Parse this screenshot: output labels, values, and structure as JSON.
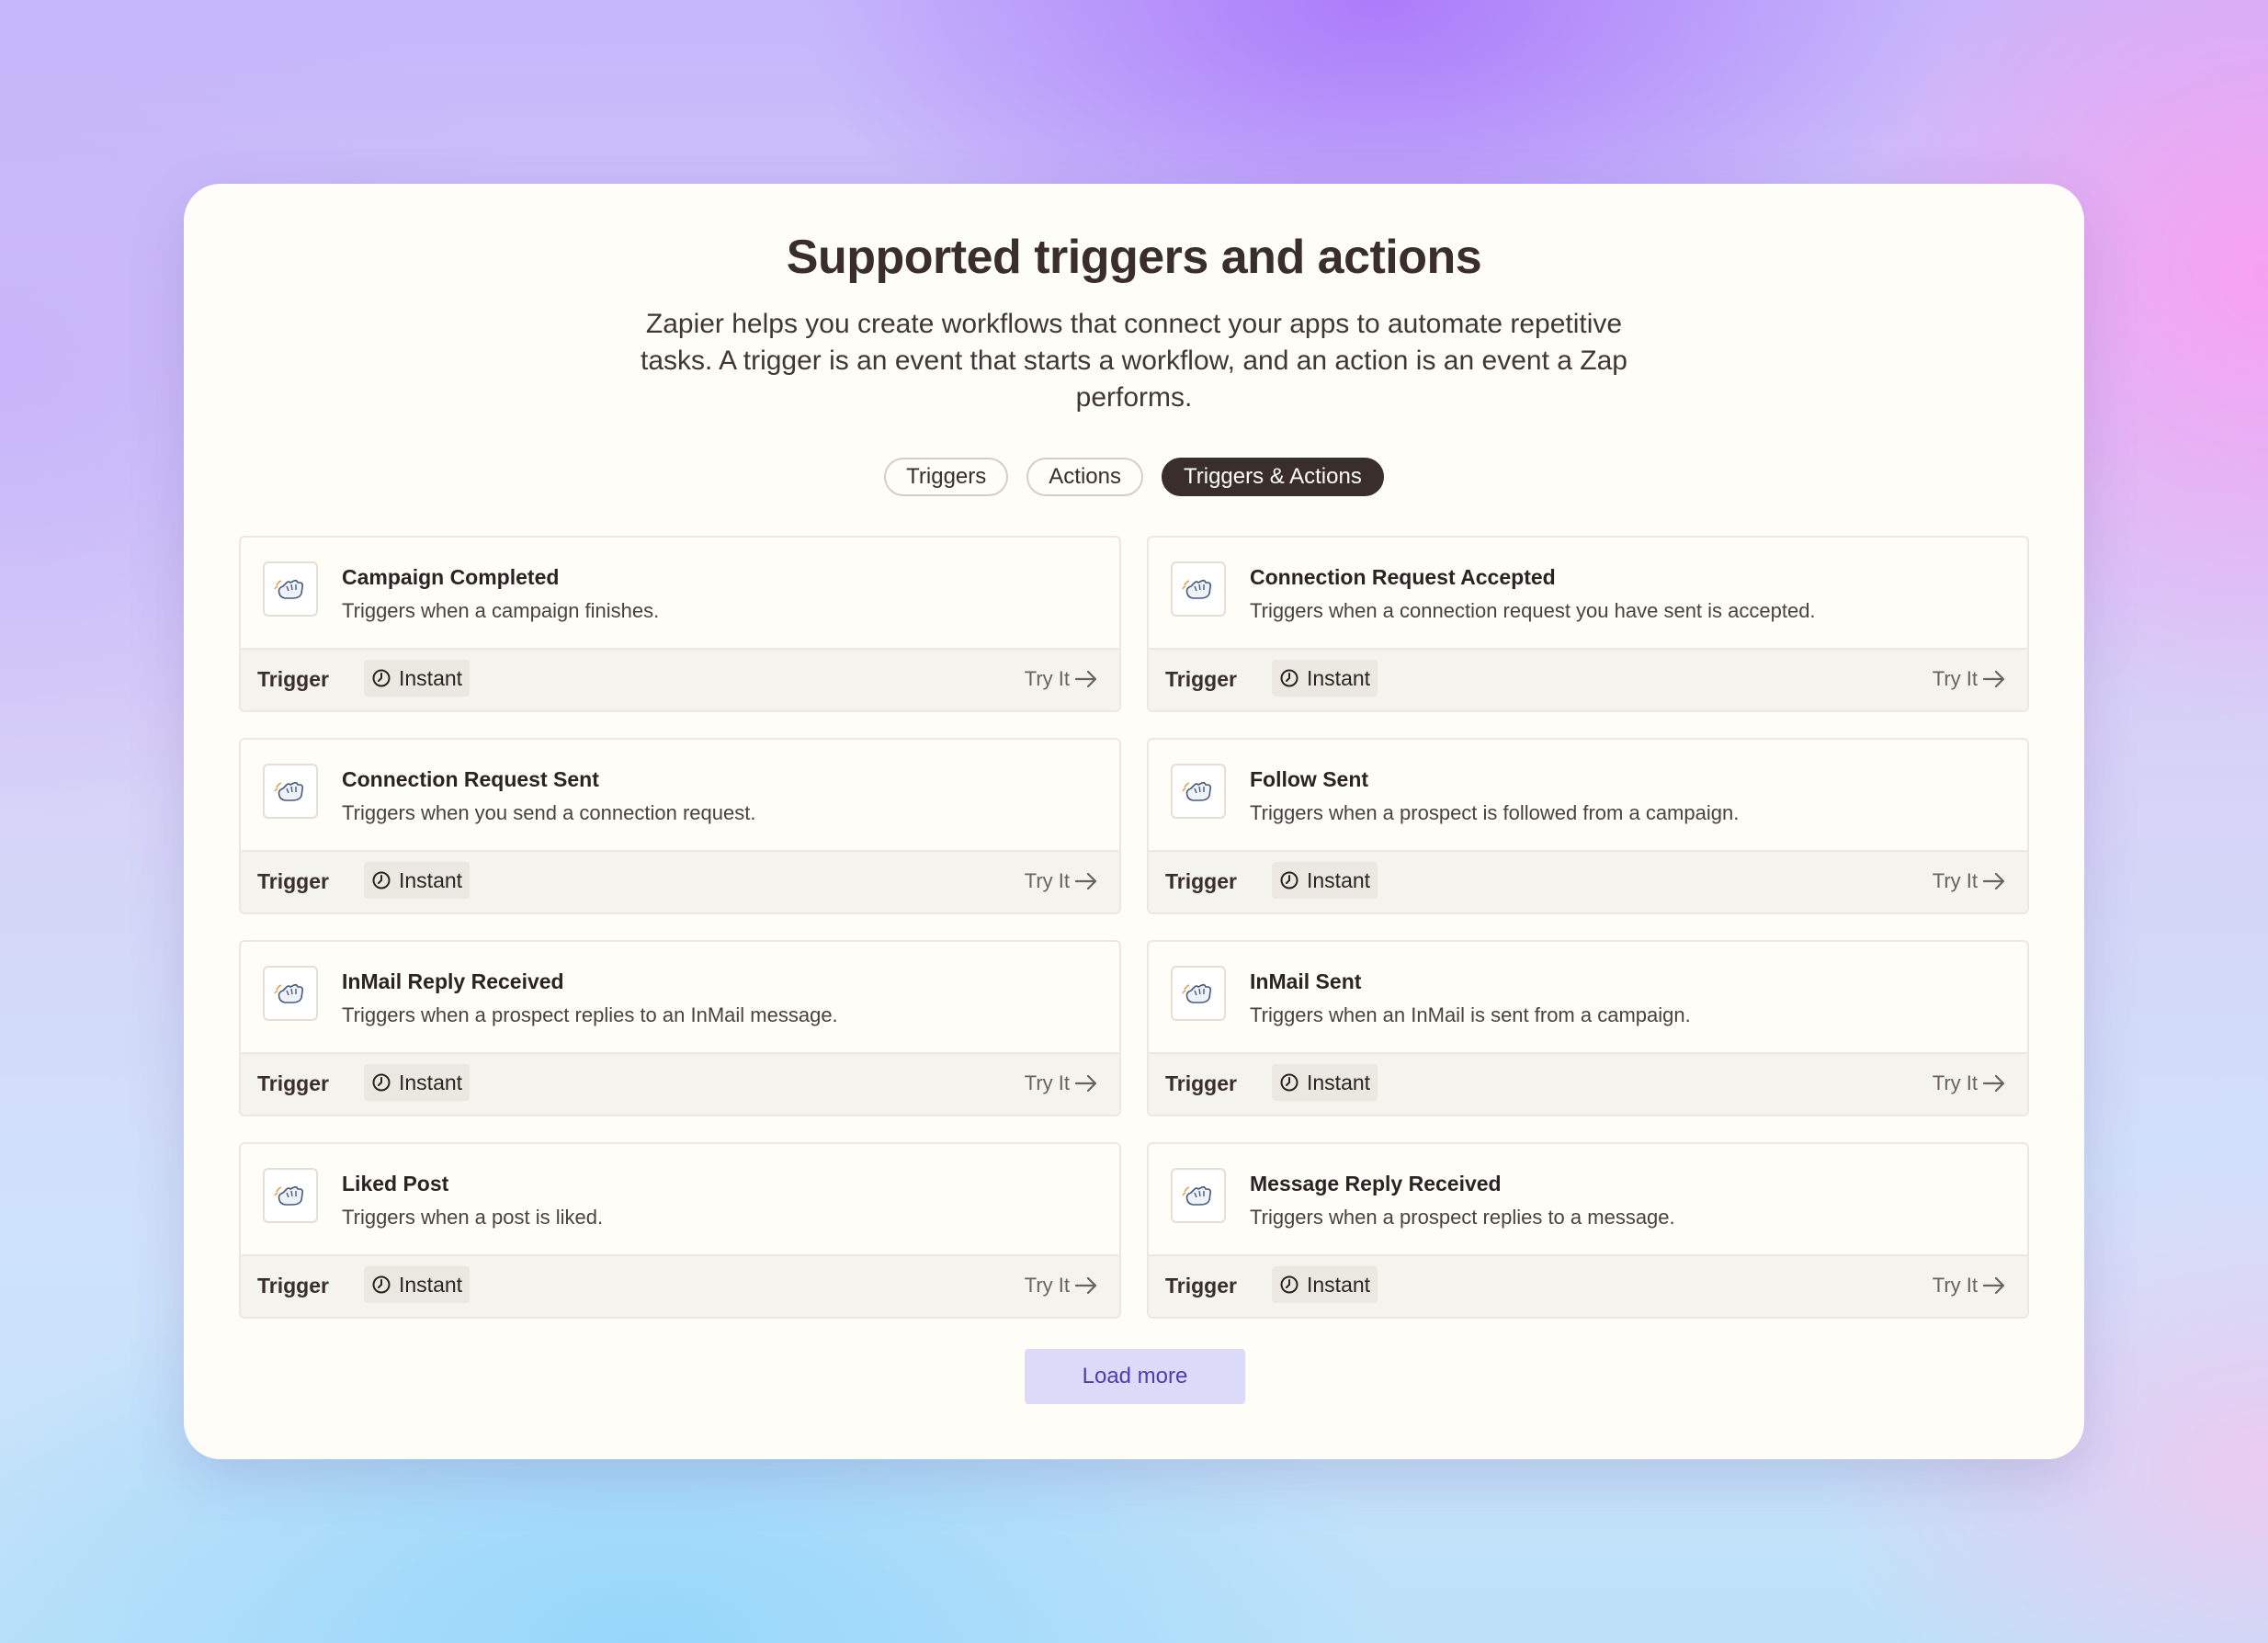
{
  "header": {
    "title": "Supported triggers and actions",
    "subtitle": "Zapier helps you create workflows that connect your apps to automate repetitive tasks. A trigger is an event that starts a workflow, and an action is an event a Zap performs."
  },
  "filters": {
    "triggers": "Triggers",
    "actions": "Actions",
    "both": "Triggers & Actions",
    "selected": "Triggers & Actions"
  },
  "items": [
    {
      "name": "Campaign Completed",
      "desc": "Triggers when a campaign finishes.",
      "type": "Trigger",
      "badge": "Instant",
      "cta": "Try It"
    },
    {
      "name": "Connection Request Accepted",
      "desc": "Triggers when a connection request you have sent is accepted.",
      "type": "Trigger",
      "badge": "Instant",
      "cta": "Try It"
    },
    {
      "name": "Connection Request Sent",
      "desc": "Triggers when you send a connection request.",
      "type": "Trigger",
      "badge": "Instant",
      "cta": "Try It"
    },
    {
      "name": "Follow Sent",
      "desc": "Triggers when a prospect is followed from a campaign.",
      "type": "Trigger",
      "badge": "Instant",
      "cta": "Try It"
    },
    {
      "name": "InMail Reply Received",
      "desc": "Triggers when a prospect replies to an InMail message.",
      "type": "Trigger",
      "badge": "Instant",
      "cta": "Try It"
    },
    {
      "name": "InMail Sent",
      "desc": "Triggers when an InMail is sent from a campaign.",
      "type": "Trigger",
      "badge": "Instant",
      "cta": "Try It"
    },
    {
      "name": "Liked Post",
      "desc": "Triggers when a post is liked.",
      "type": "Trigger",
      "badge": "Instant",
      "cta": "Try It"
    },
    {
      "name": "Message Reply Received",
      "desc": "Triggers when a prospect replies to a message.",
      "type": "Trigger",
      "badge": "Instant",
      "cta": "Try It"
    }
  ],
  "load_more": "Load more",
  "icons": {
    "app_logo": "hand-wave-logo-icon",
    "badge": "clock-icon",
    "cta": "arrow-right-icon"
  },
  "colors": {
    "accent_dark": "#3a2e2d",
    "load_more_bg": "#dcdaf8",
    "load_more_text": "#4a3fb0",
    "card_bg": "#fffdf8"
  }
}
